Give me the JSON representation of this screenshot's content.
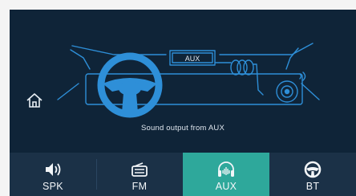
{
  "screen": {
    "source_badge": "AUX",
    "status_text": "Sound output from AUX"
  },
  "tabs": [
    {
      "id": "spk",
      "label": "SPK",
      "icon": "speaker-icon",
      "active": false
    },
    {
      "id": "fm",
      "label": "FM",
      "icon": "radio-icon",
      "active": false
    },
    {
      "id": "aux",
      "label": "AUX",
      "icon": "headphones-icon",
      "active": true
    },
    {
      "id": "bt",
      "label": "BT",
      "icon": "steering-wheel-icon",
      "active": false
    }
  ],
  "colors": {
    "background": "#0f2438",
    "line_art": "#2e8fd8",
    "tabbar": "#1b3147",
    "active_tab": "#2ea89b",
    "text": "#ffffff"
  }
}
